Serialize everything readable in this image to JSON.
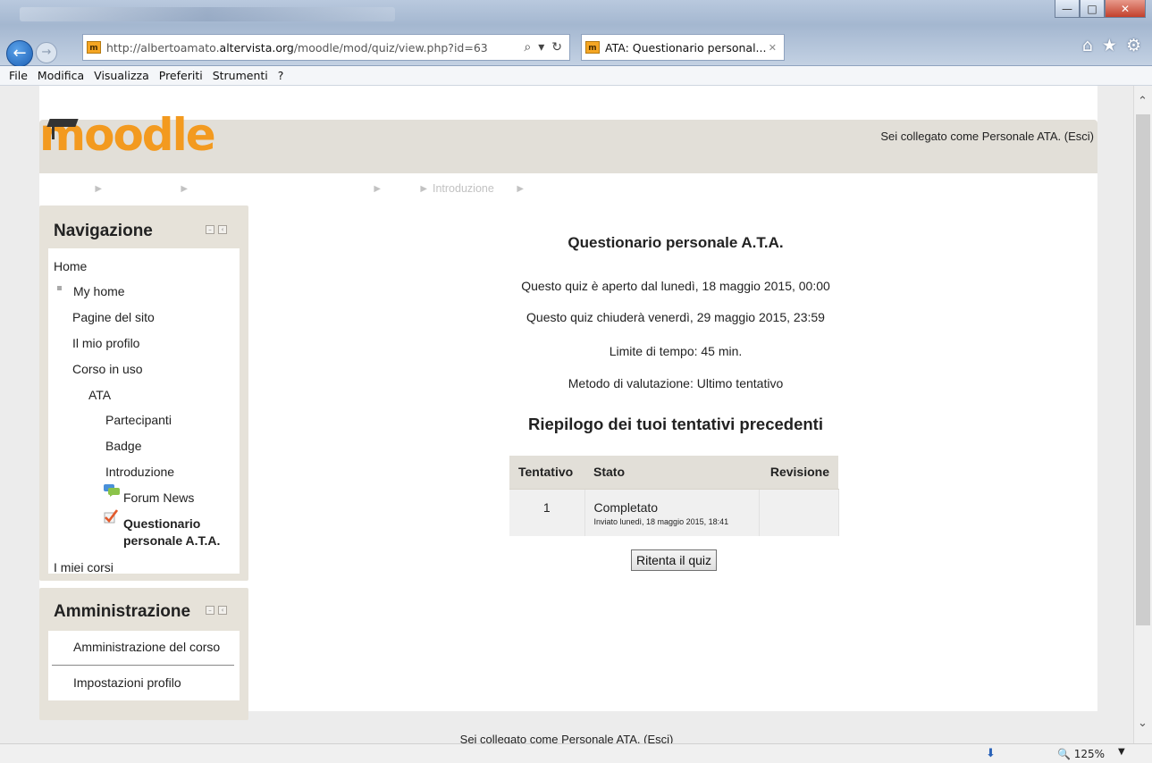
{
  "browser": {
    "url_prefix": "http://albertoamato.",
    "url_domain": "altervista.org",
    "url_path": "/moodle/mod/quiz/view.php?id=63",
    "tab_title": "ATA: Questionario personal...",
    "favicon_text": "m",
    "menu": [
      "File",
      "Modifica",
      "Visualizza",
      "Preferiti",
      "Strumenti",
      "?"
    ],
    "zoom": "125%"
  },
  "header": {
    "logo_text": "moodle",
    "login_info": "Sei collegato come Personale ATA. (Esci)"
  },
  "breadcrumb": {
    "current": "Introduzione"
  },
  "navigation": {
    "title": "Navigazione",
    "items": {
      "home": "Home",
      "my_home": "My home",
      "site_pages": "Pagine del sito",
      "profile": "Il mio profilo",
      "current_course": "Corso in uso",
      "ata": "ATA",
      "participants": "Partecipanti",
      "badge": "Badge",
      "intro": "Introduzione",
      "forum": "Forum News",
      "quiz_line1": "Questionario",
      "quiz_line2": "personale A.T.A.",
      "my_courses": "I miei corsi"
    }
  },
  "administration": {
    "title": "Amministrazione",
    "items": {
      "course_admin": "Amministrazione del corso",
      "profile_settings": "Impostazioni profilo"
    }
  },
  "quiz": {
    "title": "Questionario personale A.T.A.",
    "open": "Questo quiz è aperto dal lunedì, 18 maggio 2015, 00:00",
    "close": "Questo quiz chiuderà venerdì, 29 maggio 2015, 23:59",
    "time_limit": "Limite di tempo: 45 min.",
    "grading": "Metodo di valutazione: Ultimo tentativo",
    "summary_title": "Riepilogo dei tuoi tentativi precedenti",
    "table": {
      "headers": [
        "Tentativo",
        "Stato",
        "Revisione"
      ],
      "rows": [
        {
          "attempt": "1",
          "status": "Completato",
          "submitted": "Inviato lunedì, 18 maggio 2015, 18:41",
          "review": ""
        }
      ]
    },
    "retry_button": "Ritenta il quiz"
  },
  "footer": {
    "login_info": "Sei collegato come Personale ATA. (Esci)"
  }
}
